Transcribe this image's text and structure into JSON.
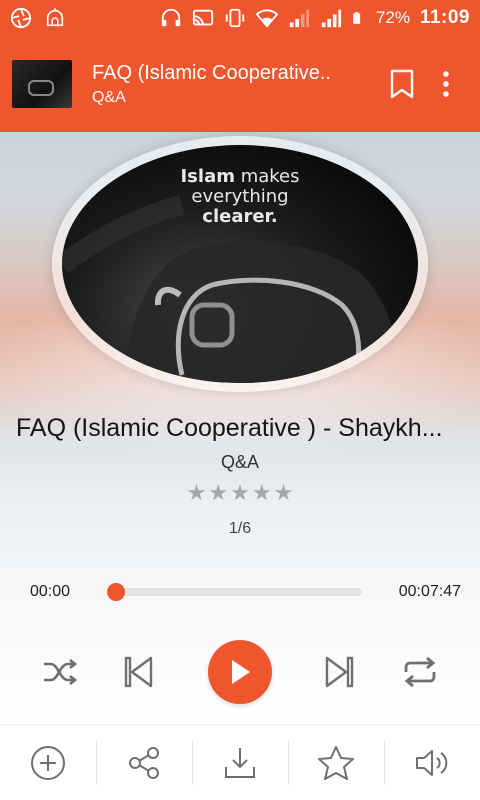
{
  "status_bar": {
    "battery": "72%",
    "time": "11:09",
    "icons": [
      "camera-shutter-icon",
      "mosque-icon",
      "headphones-icon",
      "cast-icon",
      "vibrate-icon",
      "wifi-icon",
      "signal-weak-icon",
      "signal-icon",
      "battery-icon"
    ]
  },
  "app_bar": {
    "title": "FAQ (Islamic Cooperative..",
    "subtitle": "Q&A",
    "actions": [
      "bookmark-icon",
      "overflow-menu-icon"
    ]
  },
  "artwork": {
    "line1_a": "Islam",
    "line1_b": " makes",
    "line2": "everything",
    "line3": "clearer."
  },
  "track": {
    "title": "FAQ (Islamic Cooperative ) - Shaykh...",
    "artist": "Q&A",
    "rating": 0,
    "rating_max": 5,
    "position_label": "1/6"
  },
  "progress": {
    "current": "00:00",
    "total": "00:07:47",
    "fraction": 0.03
  },
  "controls": [
    "shuffle-icon",
    "previous-icon",
    "play-icon",
    "next-icon",
    "repeat-icon"
  ],
  "bottom_actions": [
    "add-icon",
    "share-icon",
    "download-icon",
    "star-outline-icon",
    "volume-icon"
  ],
  "colors": {
    "accent": "#f0562d",
    "icon_gray": "#6f6f6f"
  }
}
